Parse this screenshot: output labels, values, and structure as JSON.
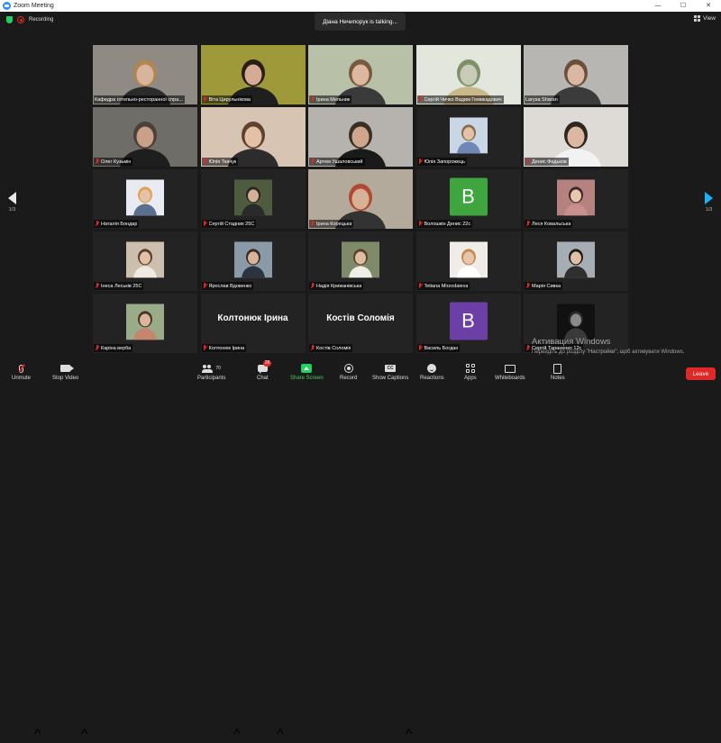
{
  "window": {
    "title": "Zoom Meeting",
    "controls": [
      "—",
      "☐",
      "✕"
    ]
  },
  "recording": {
    "label": "Recording"
  },
  "talking_banner": "Діана Нечипорук is talking...",
  "view_button": "View",
  "pagination": {
    "left": "1/3",
    "right": "1/3"
  },
  "participants": [
    {
      "name": "Кафедра готельно-ресторанної спра...",
      "muted": false,
      "tile": "video",
      "bg": "#8f8a83",
      "skin": "#d8b49c",
      "hair": "#b18655",
      "shirt": "#2b2b2b"
    },
    {
      "name": "Віта Цирульнікова",
      "muted": true,
      "tile": "video",
      "bg": "#9e9a3a",
      "skin": "#d5ac93",
      "hair": "#2a1c16",
      "shirt": "#1f1f1f"
    },
    {
      "name": "Ірина Мельник",
      "muted": true,
      "tile": "video",
      "bg": "#b9c0a8",
      "skin": "#dcb89e",
      "hair": "#7a5a3e",
      "shirt": "#3a3a3a"
    },
    {
      "name": "Сергій Чичко Вадим Гемикадович",
      "muted": true,
      "tile": "video",
      "bg": "#e3e6dc",
      "skin": "#c7cbb8",
      "hair": "#7f8f6a",
      "shirt": "#c9b98a"
    },
    {
      "name": "Larysa Sharan",
      "muted": false,
      "tile": "video",
      "bg": "#b8b6b2",
      "skin": "#d9b7a1",
      "hair": "#6a4f3c",
      "shirt": "#3b3b3b"
    },
    {
      "name": "Олег Кузьмін",
      "muted": true,
      "tile": "video",
      "bg": "#6f6d68",
      "skin": "#c9a088",
      "hair": "#4a4039",
      "shirt": "#1e1e1e"
    },
    {
      "name": "Юлія Ткачук",
      "muted": true,
      "tile": "video",
      "bg": "#d7c4b3",
      "skin": "#e4c0a6",
      "hair": "#5f4130",
      "shirt": "#2d2b2b"
    },
    {
      "name": "Артем Ушаловський",
      "muted": true,
      "tile": "video",
      "bg": "#b6b3ae",
      "skin": "#cfa68c",
      "hair": "#3a2e26",
      "shirt": "#1a1a1a",
      "active": true
    },
    {
      "name": "Юлія Запорожець",
      "muted": true,
      "tile": "photo",
      "bg": "#c9d6e6",
      "skin": "#e3c3a8",
      "hair": "#8a6c4f",
      "shirt": "#6f87b5"
    },
    {
      "name": "Денис Федьков",
      "muted": true,
      "tile": "video",
      "bg": "#dedad5",
      "skin": "#dbb89f",
      "hair": "#2d2621",
      "shirt": "#f2f2f2"
    },
    {
      "name": "Наталія Бондар",
      "muted": true,
      "tile": "photo",
      "bg": "#e8ecf2",
      "skin": "#e4c3a8",
      "hair": "#e2a24a",
      "shirt": "#5b6f8f"
    },
    {
      "name": "Сергій Стадник 25С",
      "muted": true,
      "tile": "photo",
      "bg": "#4f5b3f",
      "skin": "#d3b097",
      "hair": "#2c2620",
      "shirt": "#2a2a2a"
    },
    {
      "name": "Ірина Корецька",
      "muted": true,
      "tile": "video",
      "bg": "#b3aa9c",
      "skin": "#d7b296",
      "hair": "#b04a30",
      "shirt": "#333333"
    },
    {
      "name": "Волошкін Денис 22с",
      "muted": true,
      "tile": "avatar",
      "letter": "B",
      "color": "#3fa63f"
    },
    {
      "name": "Леся Ковальська",
      "muted": true,
      "tile": "photo",
      "bg": "#b5827f",
      "skin": "#e7c7b0",
      "hair": "#3b2a23",
      "shirt": "#c98f8d"
    },
    {
      "name": "Інеса Леськів 25С",
      "muted": true,
      "tile": "photo",
      "bg": "#cdbfae",
      "skin": "#e2c2a6",
      "hair": "#5a3d2b",
      "shirt": "#efe9e1"
    },
    {
      "name": "Ярослав Вдовенко",
      "muted": true,
      "tile": "photo",
      "bg": "#8a9aa6",
      "skin": "#d8b49a",
      "hair": "#3a2c22",
      "shirt": "#2b3340"
    },
    {
      "name": "Надія Крижанівська",
      "muted": true,
      "tile": "photo",
      "bg": "#7e8a6a",
      "skin": "#e0bea3",
      "hair": "#5b4230",
      "shirt": "#f0ede6"
    },
    {
      "name": "Tetiana Mirzodaieva",
      "muted": true,
      "tile": "photo",
      "bg": "#f0ede8",
      "skin": "#e6c6ad",
      "hair": "#c7884f",
      "shirt": "#ffffff"
    },
    {
      "name": "Марія Сивка",
      "muted": true,
      "tile": "photo",
      "bg": "#a6adb3",
      "skin": "#dfc0a5",
      "hair": "#1f1a17",
      "shirt": "#2f2f2f"
    },
    {
      "name": "Каріна верба",
      "muted": true,
      "tile": "photo",
      "bg": "#9aab8a",
      "skin": "#d9b69c",
      "hair": "#4a3425",
      "shirt": "#c4866e"
    },
    {
      "name": "Колтонюк Ірина",
      "muted": true,
      "tile": "text",
      "display": "Колтонюк Ірина"
    },
    {
      "name": "Костів Соломія",
      "muted": true,
      "tile": "text",
      "display": "Костів Соломія"
    },
    {
      "name": "Василь Богдан",
      "muted": true,
      "tile": "avatar",
      "letter": "B",
      "color": "#6b3fa6"
    },
    {
      "name": "Сергій Тараненко 12с",
      "muted": true,
      "tile": "photo",
      "bg": "#111111",
      "skin": "#8a8a8a",
      "hair": "#2a2a2a",
      "shirt": "#3a3a3a"
    }
  ],
  "toolbar": {
    "unmute": "Unmute",
    "stop_video": "Stop Video",
    "participants": "Participants",
    "participants_count": "70",
    "chat": "Chat",
    "chat_badge": "26",
    "share_screen": "Share Screen",
    "record": "Record",
    "captions": "Show Captions",
    "captions_icon": "CC",
    "reactions": "Reactions",
    "apps": "Apps",
    "whiteboards": "Whiteboards",
    "notes": "Notes",
    "leave": "Leave"
  },
  "watermark": {
    "title": "Активация Windows",
    "subtitle": "Перейдіть до розділу \"Настройки\", щоб активувати Windows."
  }
}
